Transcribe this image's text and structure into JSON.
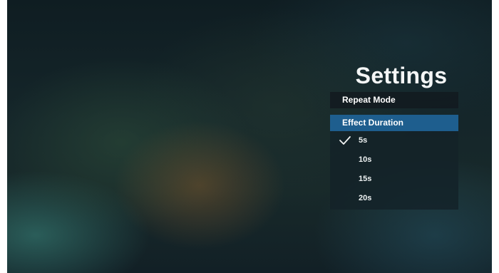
{
  "settings": {
    "title": "Settings"
  },
  "menu": {
    "repeat_mode": "Repeat Mode",
    "effect_duration": "Effect Duration"
  },
  "duration_options": [
    {
      "label": "5s",
      "selected": true
    },
    {
      "label": "10s",
      "selected": false
    },
    {
      "label": "15s",
      "selected": false
    },
    {
      "label": "20s",
      "selected": false
    }
  ],
  "icons": {
    "selected_marker": "checkmark-icon"
  },
  "colors": {
    "focus_highlight": "#1e5e8e",
    "text": "#ffffff"
  }
}
